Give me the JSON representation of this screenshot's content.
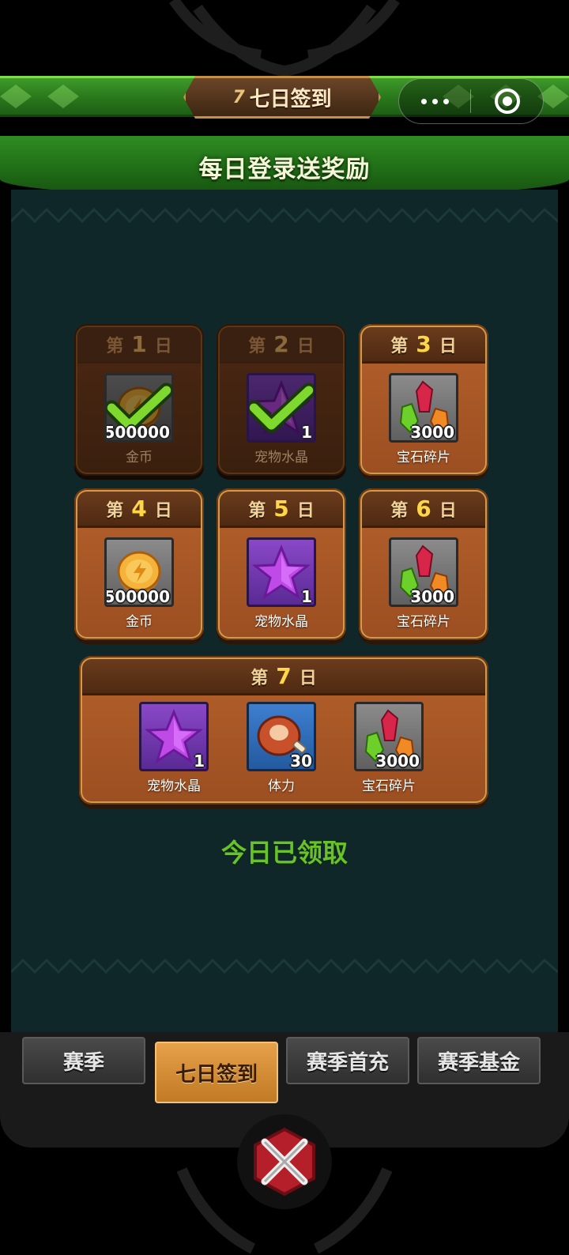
{
  "header": {
    "seven_glyph": "7",
    "title": "七日签到",
    "subtitle": "每日登录送奖励"
  },
  "capsule": {
    "more_icon": "more-dots-icon",
    "close_icon": "target-close-icon"
  },
  "days": [
    {
      "prefix": "第",
      "num": "1",
      "suffix": "日",
      "claimed": true,
      "item": {
        "icon": "gold-coin-icon",
        "qty": "500000",
        "name": "金币"
      }
    },
    {
      "prefix": "第",
      "num": "2",
      "suffix": "日",
      "claimed": true,
      "item": {
        "icon": "pet-crystal-icon",
        "qty": "1",
        "name": "宠物水晶"
      }
    },
    {
      "prefix": "第",
      "num": "3",
      "suffix": "日",
      "claimed": false,
      "item": {
        "icon": "gem-shards-icon",
        "qty": "3000",
        "name": "宝石碎片"
      }
    },
    {
      "prefix": "第",
      "num": "4",
      "suffix": "日",
      "claimed": false,
      "item": {
        "icon": "gold-coin-icon",
        "qty": "500000",
        "name": "金币"
      }
    },
    {
      "prefix": "第",
      "num": "5",
      "suffix": "日",
      "claimed": false,
      "item": {
        "icon": "pet-crystal-icon",
        "qty": "1",
        "name": "宠物水晶"
      }
    },
    {
      "prefix": "第",
      "num": "6",
      "suffix": "日",
      "claimed": false,
      "item": {
        "icon": "gem-shards-icon",
        "qty": "3000",
        "name": "宝石碎片"
      }
    }
  ],
  "day7": {
    "prefix": "第",
    "num": "7",
    "suffix": "日",
    "items": [
      {
        "icon": "pet-crystal-icon",
        "qty": "1",
        "name": "宠物水晶"
      },
      {
        "icon": "meat-stamina-icon",
        "qty": "30",
        "name": "体力"
      },
      {
        "icon": "gem-shards-icon",
        "qty": "3000",
        "name": "宝石碎片"
      }
    ]
  },
  "status": "今日已领取",
  "tabs": [
    {
      "label": "赛季",
      "active": false
    },
    {
      "label": "七日签到",
      "active": true
    },
    {
      "label": "赛季首充",
      "active": false
    },
    {
      "label": "赛季基金",
      "active": false
    }
  ],
  "colors": {
    "accent_green": "#6ac22a",
    "banner_green": "#2a7a1c",
    "card_orange": "#b4602a",
    "tab_active": "#e6a14a"
  }
}
